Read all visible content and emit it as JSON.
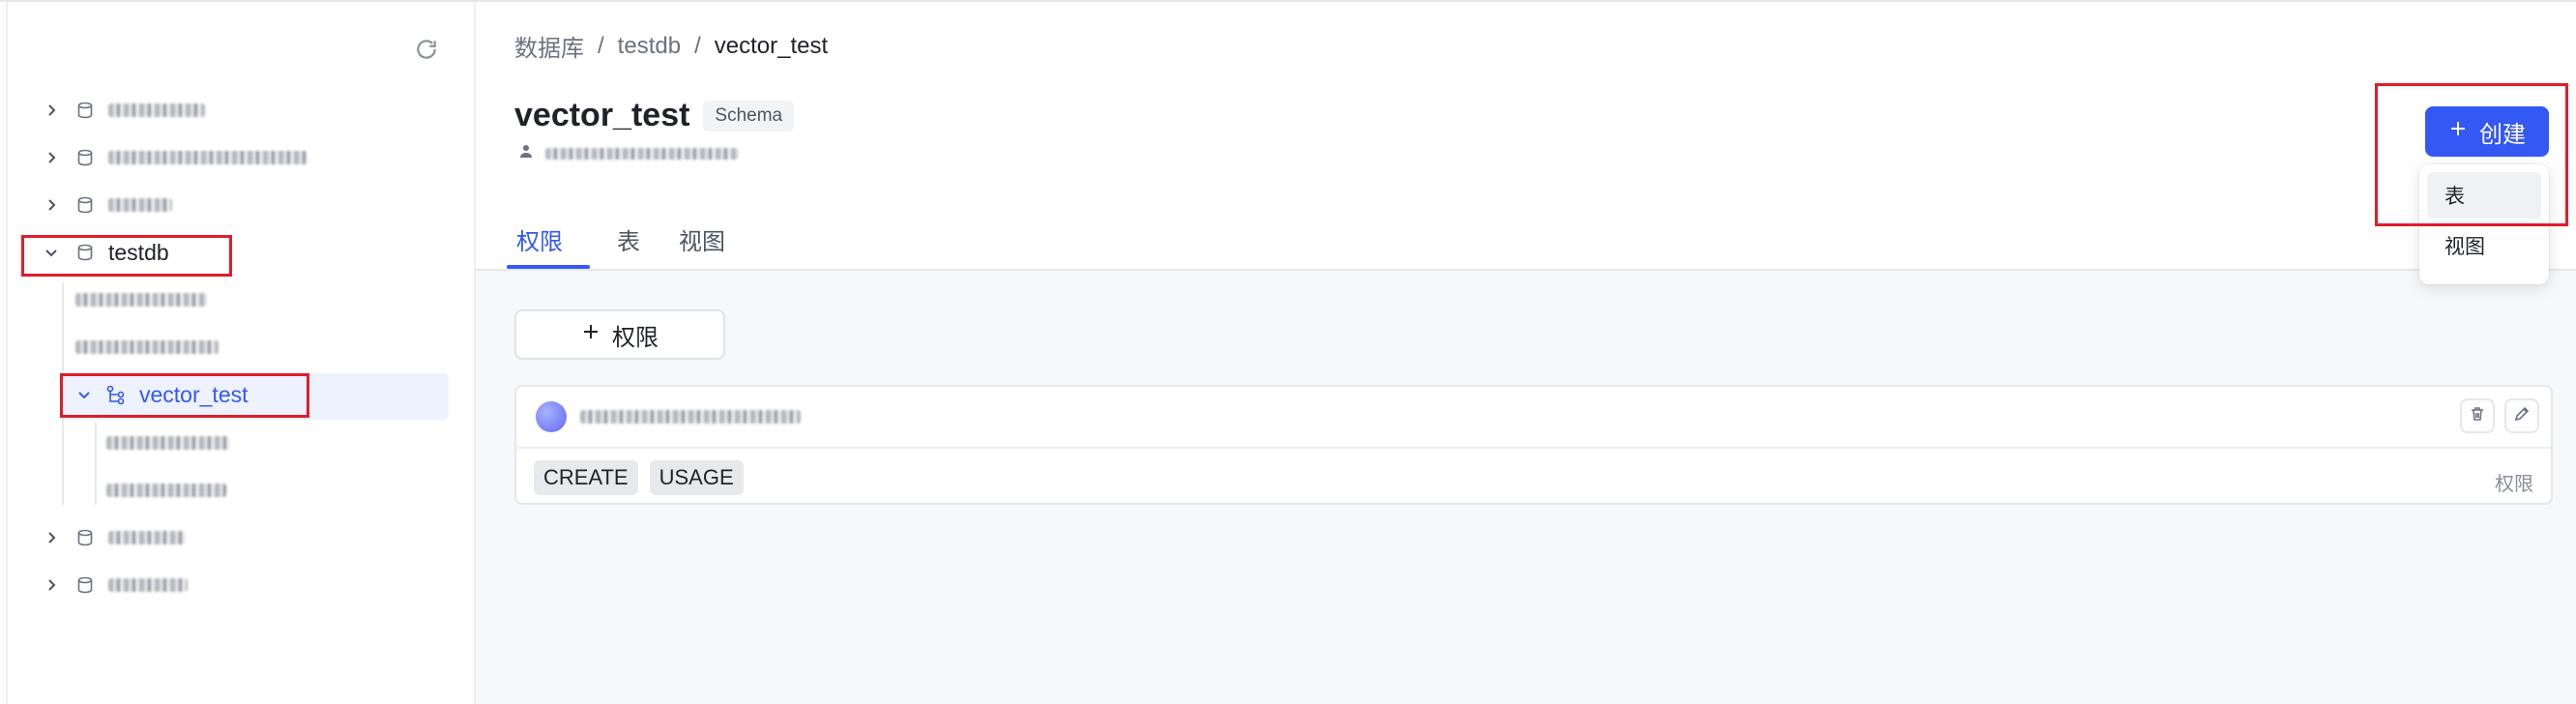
{
  "breadcrumb": {
    "root": "数据库",
    "sep": "/",
    "db": "testdb",
    "schema": "vector_test"
  },
  "header": {
    "title": "vector_test",
    "badge": "Schema"
  },
  "tabs": [
    {
      "label": "权限",
      "active": true
    },
    {
      "label": "表",
      "active": false
    },
    {
      "label": "视图",
      "active": false
    }
  ],
  "toolbar": {
    "add_permission_label": "权限",
    "create_label": "创建"
  },
  "create_menu": {
    "items": [
      "表",
      "视图"
    ],
    "hovered": "表"
  },
  "permission_card": {
    "privileges": [
      "CREATE",
      "USAGE"
    ],
    "label": "权限"
  },
  "sidebar": {
    "expanded_db": "testdb",
    "selected_schema": "vector_test"
  },
  "colors": {
    "accent": "#3358f4",
    "highlight_box": "#e11d2a",
    "selected_row_bg": "#eef2ff"
  },
  "icons": [
    "refresh-icon",
    "chevron-right-icon",
    "chevron-down-icon",
    "database-icon",
    "schema-icon",
    "plus-icon",
    "trash-icon",
    "edit-icon",
    "user-icon"
  ]
}
